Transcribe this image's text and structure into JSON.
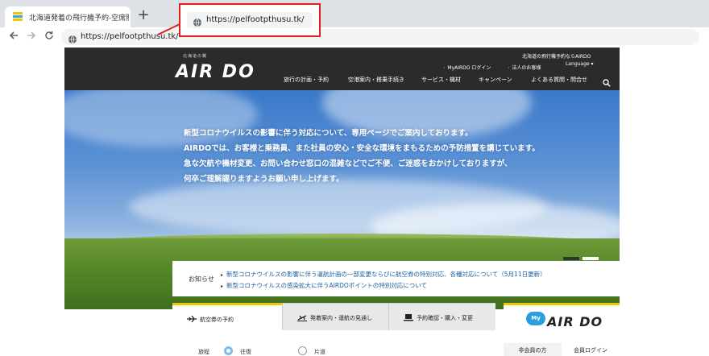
{
  "browser": {
    "tab_title": "北海道発着の飛行機予約-空席照会",
    "new_tab_glyph": "+",
    "url": "https://pelfootpthusu.tk/",
    "callout_url": "https://pelfootpthusu.tk/",
    "icons": [
      "back-arrow-icon",
      "forward-arrow-icon",
      "reload-icon",
      "globe-icon",
      "new-tab-icon"
    ]
  },
  "header": {
    "logo_sub": "北海道の翼",
    "logo": "AIR DO",
    "tagline": "北海道の飛行機予約ならAIRDO",
    "util": {
      "myairdo_login": "MyAIRDO ログイン",
      "corporate": "法人のお客様",
      "language": "Language"
    },
    "nav": [
      "旅行の計画・予約",
      "空港案内・搭乗手続き",
      "サービス・機材",
      "キャンペーン",
      "よくある質問・問合せ"
    ]
  },
  "hero": {
    "lines": [
      "新型コロナウイルスの影響に伴う対応について、専用ページでご案内しております。",
      "AIRDOでは、お客様と乗務員、また社員の安心・安全な環境をまもるための予防措置を講じています。",
      "急な欠航や機材変更、お問い合わせ窓口の混雑などでご不便、ご迷惑をおかけしておりますが、",
      "何卒ご理解賜りますようお願い申し上げます。"
    ]
  },
  "notice": {
    "label": "お知らせ",
    "items": [
      "新型コロナウイルスの影響に伴う運航計画の一部変更ならびに航空券の特別対応、各種対応について（5月11日更新）",
      "新型コロナウイルスの感染拡大に伴うAIRDOポイントの特別対応について"
    ]
  },
  "booking": {
    "tabs": [
      "航空券の予約",
      "発着案内・運航の見通し",
      "予約確認・購入・変更"
    ],
    "form": {
      "label": "旅程",
      "options": [
        "往復",
        "片道"
      ],
      "selected": "往復"
    }
  },
  "myairdo": {
    "badge": "My",
    "logo": "AIR DO",
    "buttons": [
      "非会員の方",
      "会員ログイン"
    ]
  },
  "colors": {
    "accent_yellow": "#f2c500",
    "link_blue": "#1a5e9e",
    "callout_red": "#e0211b",
    "header_dark": "#2b2b2b"
  }
}
